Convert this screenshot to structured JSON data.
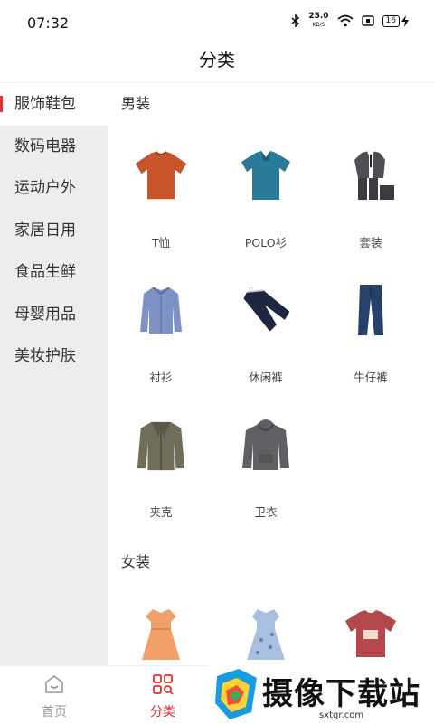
{
  "status_bar": {
    "time": "07:32",
    "network_speed": "25.0",
    "speed_unit": "KB/S",
    "battery": "16"
  },
  "header": {
    "title": "分类"
  },
  "sidebar": {
    "items": [
      {
        "label": "服饰鞋包"
      },
      {
        "label": "数码电器"
      },
      {
        "label": "运动户外"
      },
      {
        "label": "家居日用"
      },
      {
        "label": "食品生鲜"
      },
      {
        "label": "母婴用品"
      },
      {
        "label": "美妆护肤"
      }
    ]
  },
  "sections": [
    {
      "title": "男装",
      "items": [
        {
          "label": "T恤",
          "icon": "tshirt-icon"
        },
        {
          "label": "POLO衫",
          "icon": "polo-shirt-icon"
        },
        {
          "label": "套装",
          "icon": "suit-icon"
        },
        {
          "label": "衬衫",
          "icon": "shirt-icon"
        },
        {
          "label": "休闲裤",
          "icon": "casual-pants-icon"
        },
        {
          "label": "牛仔裤",
          "icon": "jeans-icon"
        },
        {
          "label": "夹克",
          "icon": "jacket-icon"
        },
        {
          "label": "卫衣",
          "icon": "hoodie-icon"
        }
      ]
    },
    {
      "title": "女装",
      "items": [
        {
          "label": "",
          "icon": "orange-dress-icon"
        },
        {
          "label": "",
          "icon": "floral-dress-icon"
        },
        {
          "label": "",
          "icon": "red-tshirt-icon"
        }
      ]
    }
  ],
  "bottom_nav": {
    "items": [
      {
        "label": "首页"
      },
      {
        "label": "分类"
      }
    ]
  },
  "watermark": {
    "text": "摄像下载站",
    "url": "sxtgr.com"
  },
  "colors": {
    "accent": "#e23131",
    "sidebar_bg": "#ededed"
  }
}
